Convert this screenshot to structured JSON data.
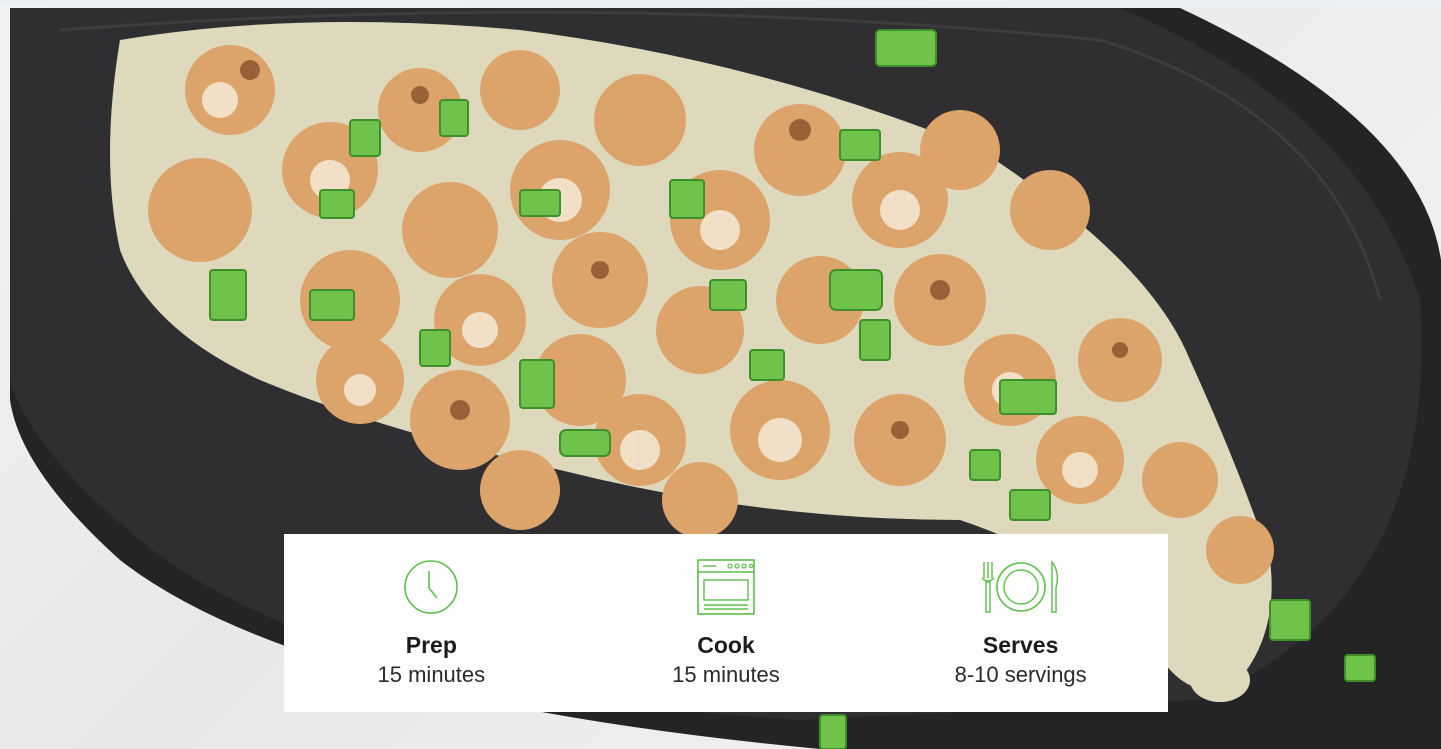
{
  "hero": {
    "image_alt": "Roasted cauliflower with creamy sauce and green onions on a black oval platter"
  },
  "recipe_stats": [
    {
      "icon": "clock-icon",
      "label": "Prep",
      "value": "15 minutes"
    },
    {
      "icon": "oven-icon",
      "label": "Cook",
      "value": "15 minutes"
    },
    {
      "icon": "plate-utensils-icon",
      "label": "Serves",
      "value": "8-10 servings"
    }
  ],
  "colors": {
    "icon_green": "#5bbf4a",
    "platter": "#2c2c2e",
    "sauce": "#e9e4c6",
    "cauliflower": "#e2b07a",
    "scallion": "#6fc24a"
  }
}
